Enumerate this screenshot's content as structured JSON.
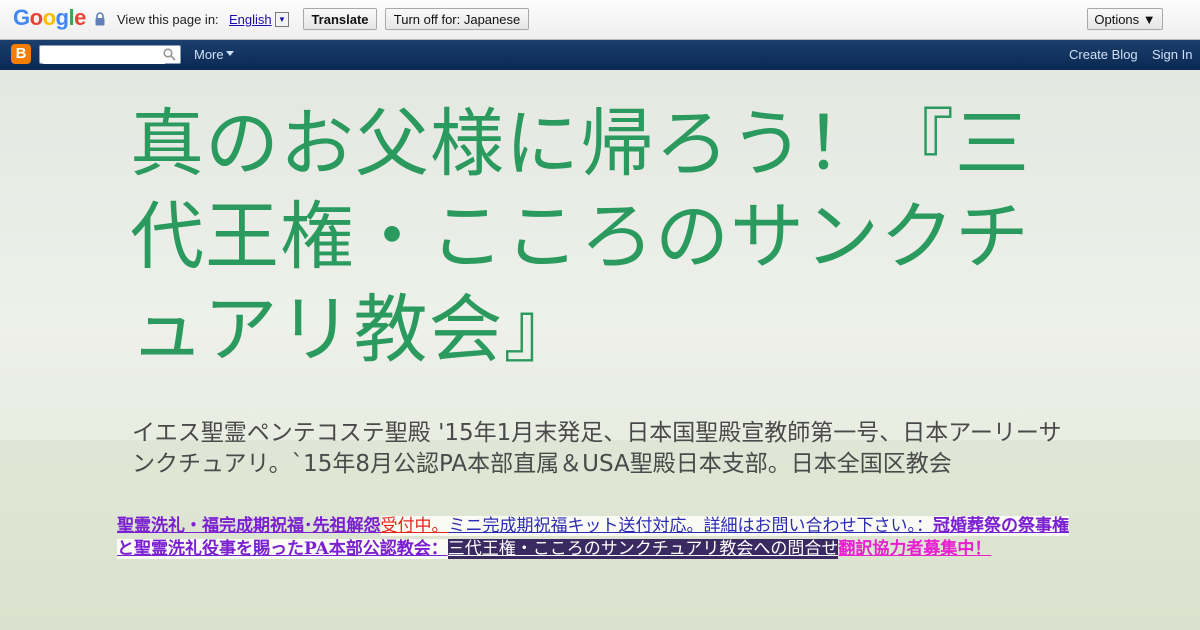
{
  "translate_bar": {
    "prompt": "View this page in:",
    "language": "English",
    "dropdown_glyph": "▼",
    "translate_label": "Translate",
    "turn_off_label": "Turn off for: Japanese",
    "options_label": "Options ▼",
    "logo": "Google"
  },
  "navbar": {
    "logo_letter": "B",
    "search_placeholder": "",
    "more_label": "More",
    "create_blog_label": "Create Blog",
    "sign_in_label": "Sign In"
  },
  "blog": {
    "title": "真のお父様に帰ろう！『三代王権・こころのサンクチュアリ教会』",
    "description": "イエス聖霊ペンテコステ聖殿 '15年1月末発足、日本国聖殿宣教師第一号、日本アーリーサンクチュアリ。`15年8月公認PA本部直属＆USA聖殿日本支部。日本全国区教会"
  },
  "marquee": {
    "part1": "聖霊洗礼・福完成期祝福･先祖解怨",
    "part2": "受付中。",
    "part3": "ミニ完成期祝福キット送付対応。詳細はお問い合わせ下さい。：",
    "part4": "冠婚葬祭の祭事権と聖霊洗礼役事を賜ったPA本部公認教会：",
    "part5": "三代王権・こころのサンクチュアリ教会への問合せ",
    "part6": "翻訳協力者募集中！"
  },
  "colors": {
    "title_green": "#2b9a5e",
    "navbar_blue": "#0a2953",
    "blogger_orange": "#f57d00"
  }
}
